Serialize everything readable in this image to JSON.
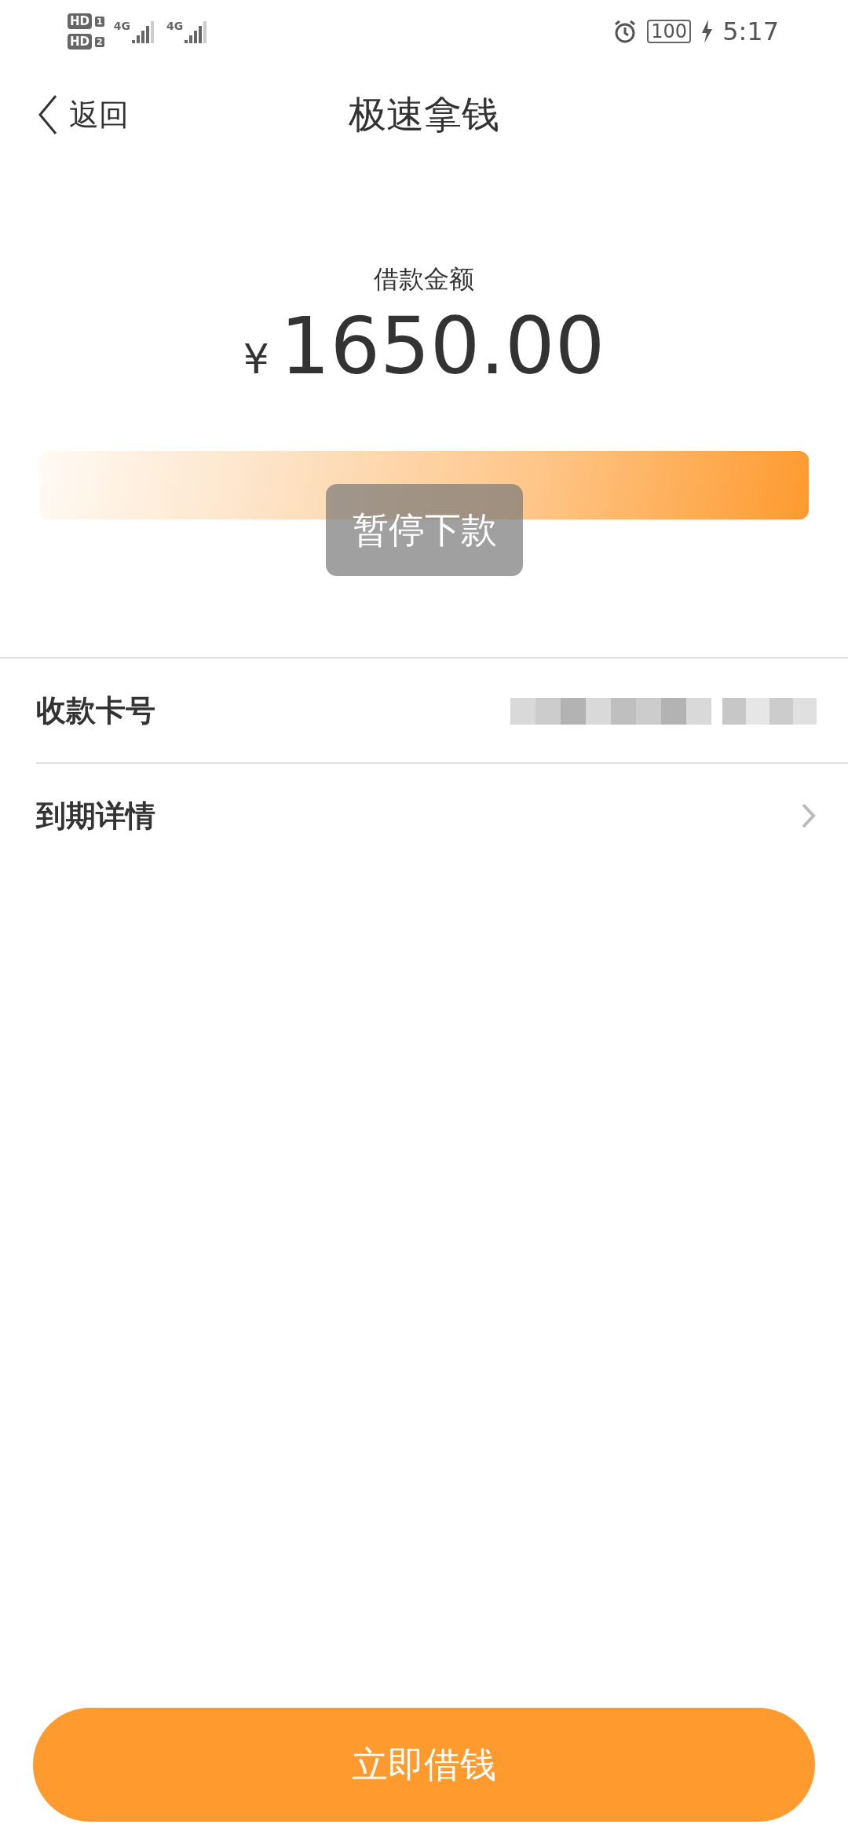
{
  "status_bar": {
    "sim_badges": [
      {
        "text": "HD",
        "slot": "1"
      },
      {
        "text": "HD",
        "slot": "2"
      }
    ],
    "networks": [
      {
        "text": "4G"
      },
      {
        "text": "4G"
      }
    ],
    "battery": "100",
    "time": "5:17"
  },
  "header": {
    "back": "返回",
    "title": "极速拿钱"
  },
  "amount": {
    "label": "借款金额",
    "currency": "¥",
    "value": "1650.00"
  },
  "toast": "暂停下款",
  "rows": [
    {
      "label": "收款卡号",
      "kind": "redacted"
    },
    {
      "label": "到期详情",
      "kind": "link"
    }
  ],
  "primary_button": "立即借钱"
}
